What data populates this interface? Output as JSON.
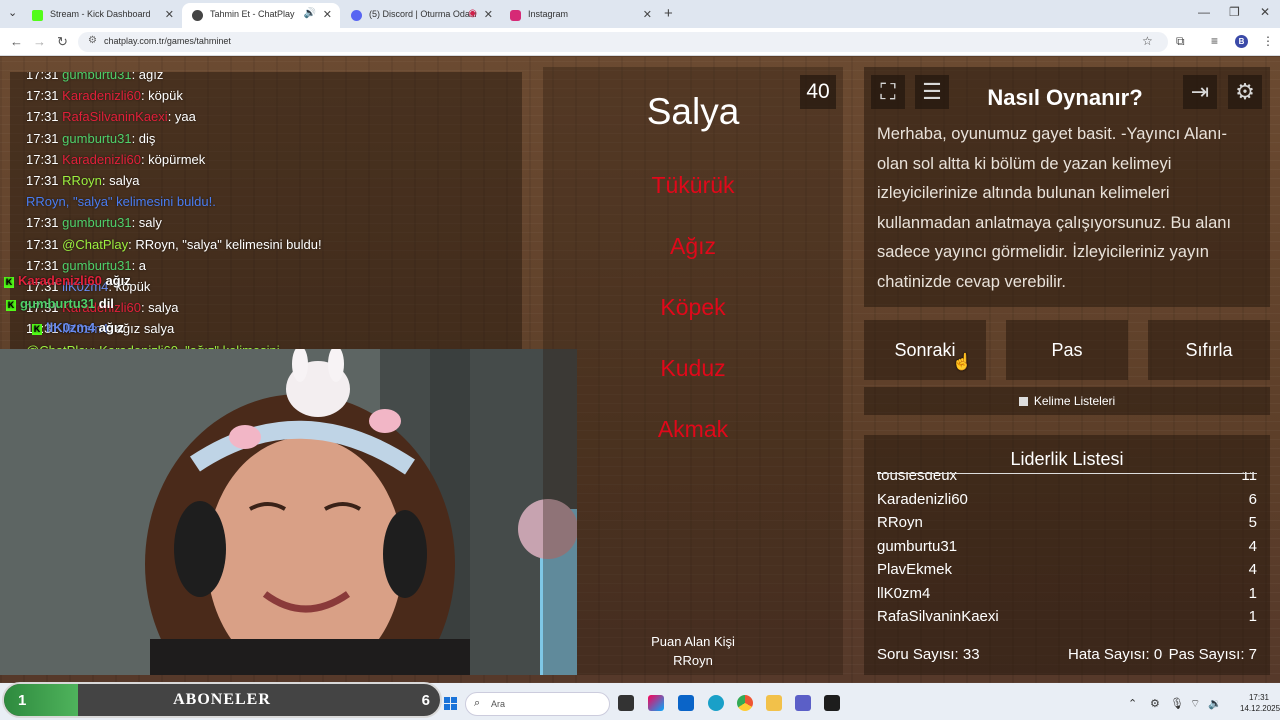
{
  "browser": {
    "tabs": [
      {
        "title": "Stream - Kick Dashboard",
        "color": "#53fc18"
      },
      {
        "title": "Tahmin Et - ChatPlay",
        "color": "#444444",
        "active": true
      },
      {
        "title": "(5) Discord | Oturma Odası",
        "color": "#5865f2"
      },
      {
        "title": "Instagram",
        "color": "#d62976"
      }
    ],
    "new_tab_icon": "+",
    "url": "chatplay.com.tr/games/tahminet",
    "profile_initial": "B"
  },
  "chat": {
    "messages": [
      {
        "time": "17:31",
        "user": "gumburtu31",
        "color": "#4fd06a",
        "text": ": ağız"
      },
      {
        "time": "17:31",
        "user": "Karadenizli60",
        "color": "#e0203a",
        "text": ": köpük"
      },
      {
        "time": "17:31",
        "user": "RafaSilvaninKaexi",
        "color": "#e0203a",
        "text": ": yaa"
      },
      {
        "time": "17:31",
        "user": "gumburtu31",
        "color": "#4fd06a",
        "text": ": diş"
      },
      {
        "time": "17:31",
        "user": "Karadenizli60",
        "color": "#e0203a",
        "text": ": köpürmek"
      },
      {
        "time": "17:31",
        "user": "RRoyn",
        "color": "#9cf040",
        "text": ": salya"
      },
      {
        "time": "",
        "user": "RRoyn, \"salya\" kelimesini buldu!.",
        "color": "#4a7cf0",
        "text": ""
      },
      {
        "time": "17:31",
        "user": "gumburtu31",
        "color": "#4fd06a",
        "text": ": saly"
      },
      {
        "time": "17:31",
        "user": "@ChatPlay",
        "color": "#9cf040",
        "text": ": RRoyn, \"salya\" kelimesini buldu!"
      },
      {
        "time": "17:31",
        "user": "gumburtu31",
        "color": "#4fd06a",
        "text": ": a"
      },
      {
        "time": "17:31",
        "user": "llK0zm4",
        "color": "#6a8cf0",
        "text": ": köpük"
      },
      {
        "time": "17:31",
        "user": "Karadenizli60",
        "color": "#e0203a",
        "text": ": salya"
      },
      {
        "time": "17:31",
        "user": "llK0zm4",
        "color": "#6a8cf0",
        "text": ": ağız salya"
      }
    ],
    "overlay": [
      {
        "user": "Karadenizli60",
        "text": "ağız"
      },
      {
        "user": "gumburtu31",
        "text": "dil"
      },
      {
        "user": "llK0zm4",
        "text": "ağız"
      }
    ],
    "cut_line": "@ChatPlay: Karadenizli60, \"ağız\" kelimesini..."
  },
  "game": {
    "timer": "40",
    "main_word": "Salya",
    "taboo_words": [
      "Tükürük",
      "Ağız",
      "Köpek",
      "Kuduz",
      "Akmak"
    ],
    "scorer_label": "Puan Alan Kişi",
    "scorer_name": "RRoyn"
  },
  "howto": {
    "title": "Nasıl Oynanır?",
    "text": "Merhaba, oyunumuz gayet basit. -Yayıncı Alanı- olan sol altta ki bölüm de yazan kelimeyi izleyicilerinize altında bulunan kelimeleri kullanmadan anlatmaya çalışıyorsunuz. Bu alanı sadece yayıncı görmelidir. İzleyicileriniz yayın chatinizde cevap verebilir.",
    "icons": [
      "fullscreen-icon",
      "list-icon",
      "exit-icon",
      "gear-icon"
    ]
  },
  "actions": {
    "next": "Sonraki",
    "pass": "Pas",
    "reset": "Sıfırla",
    "word_lists": "Kelime Listeleri"
  },
  "leaderboard": {
    "title": "Liderlik Listesi",
    "rows": [
      {
        "name": "touslesdeux",
        "score": "11"
      },
      {
        "name": "Karadenizli60",
        "score": "6"
      },
      {
        "name": "RRoyn",
        "score": "5"
      },
      {
        "name": "gumburtu31",
        "score": "4"
      },
      {
        "name": "PlavEkmek",
        "score": "4"
      },
      {
        "name": "llK0zm4",
        "score": "1"
      },
      {
        "name": "RafaSilvaninKaexi",
        "score": "1"
      }
    ],
    "question_count": "Soru Sayısı: 33",
    "error_count": "Hata Sayısı: 0",
    "pass_count": "Pas Sayısı: 7"
  },
  "subscribers": {
    "label": "ABONELER",
    "current": "1",
    "goal": "6",
    "progress": 0.17
  },
  "taskbar": {
    "search_placeholder": "Ara",
    "time": "17:31",
    "date": "14.12.2025"
  }
}
